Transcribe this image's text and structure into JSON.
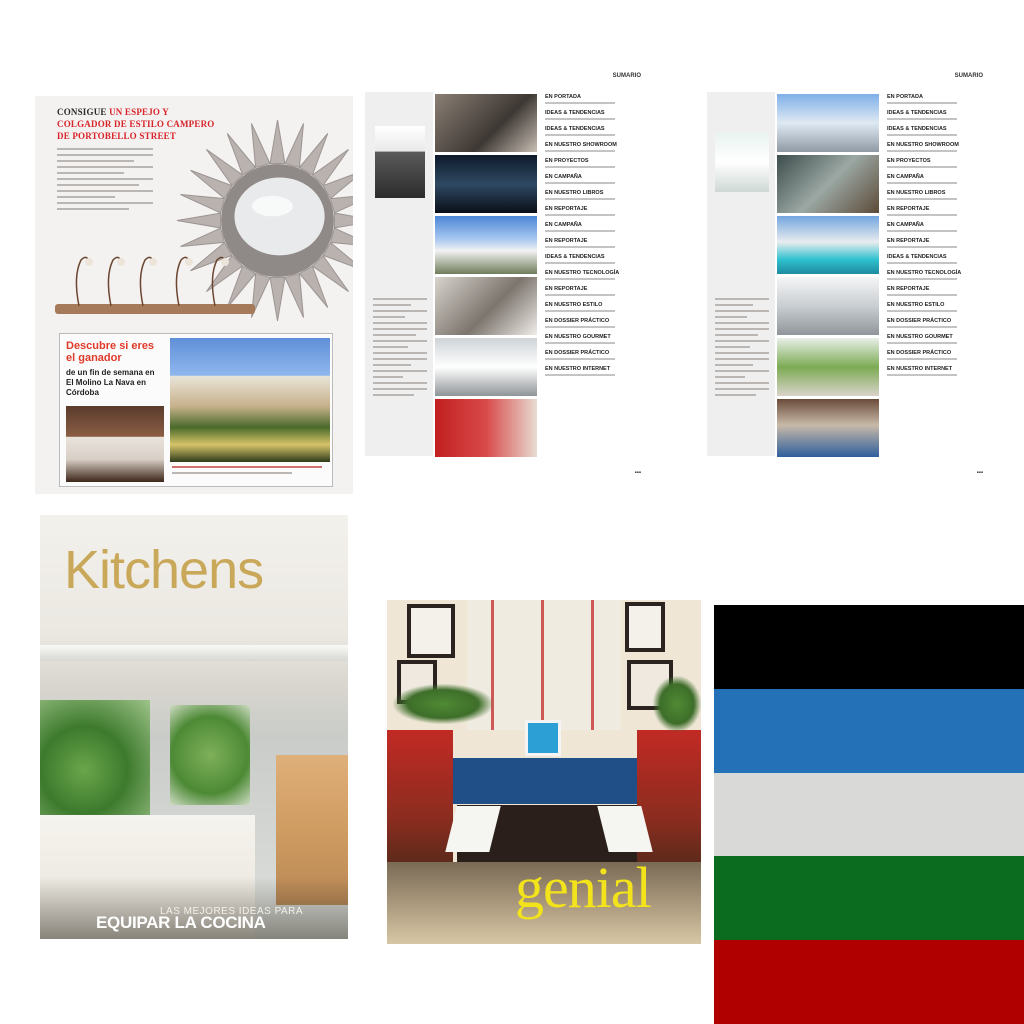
{
  "mirror_ad": {
    "heading_black": "CONSIGUE",
    "heading_red": "UN ESPEJO Y COLGADOR DE ESTILO CAMPERO DE PORTOBELLO STREET",
    "winner_title": "Descubre si eres el ganador",
    "winner_subtitle": "de un fin de semana en El Molino La Nava en Córdoba"
  },
  "index_pages": [
    {
      "label": "SUMARIO",
      "entries": [
        "EN PORTADA",
        "IDEAS & TENDENCIAS",
        "IDEAS & TENDENCIAS",
        "EN NUESTRO SHOWROOM",
        "EN PROYECTOS",
        "EN CAMPAÑA",
        "EN NUESTRO LIBROS",
        "EN REPORTAJE",
        "EN CAMPAÑA",
        "EN REPORTAJE",
        "IDEAS & TENDENCIAS",
        "EN NUESTRO TECNOLOGÍA",
        "EN REPORTAJE",
        "EN NUESTRO ESTILO",
        "EN DOSSIER PRÁCTICO",
        "EN NUESTRO GOURMET",
        "EN DOSSIER PRÁCTICO",
        "EN NUESTRO INTERNET"
      ]
    },
    {
      "label": "SUMARIO",
      "entries": [
        "EN PORTADA",
        "IDEAS & TENDENCIAS",
        "IDEAS & TENDENCIAS",
        "EN NUESTRO SHOWROOM",
        "EN PROYECTOS",
        "EN CAMPAÑA",
        "EN NUESTRO LIBROS",
        "EN REPORTAJE",
        "EN CAMPAÑA",
        "EN REPORTAJE",
        "IDEAS & TENDENCIAS",
        "EN NUESTRO TECNOLOGÍA",
        "EN REPORTAJE",
        "EN NUESTRO ESTILO",
        "EN DOSSIER PRÁCTICO",
        "EN NUESTRO GOURMET",
        "EN DOSSIER PRÁCTICO",
        "EN NUESTRO INTERNET"
      ]
    }
  ],
  "kitchens_cover": {
    "title": "Kitchens",
    "tagline": "LAS MEJORES IDEAS PARA",
    "headline": "EQUIPAR LA COCINA"
  },
  "genial_cover": {
    "title": "genial"
  },
  "palette": {
    "colors": [
      "#000000",
      "#2471b8",
      "#d9d9d7",
      "#0b6b1f",
      "#b10000"
    ]
  }
}
